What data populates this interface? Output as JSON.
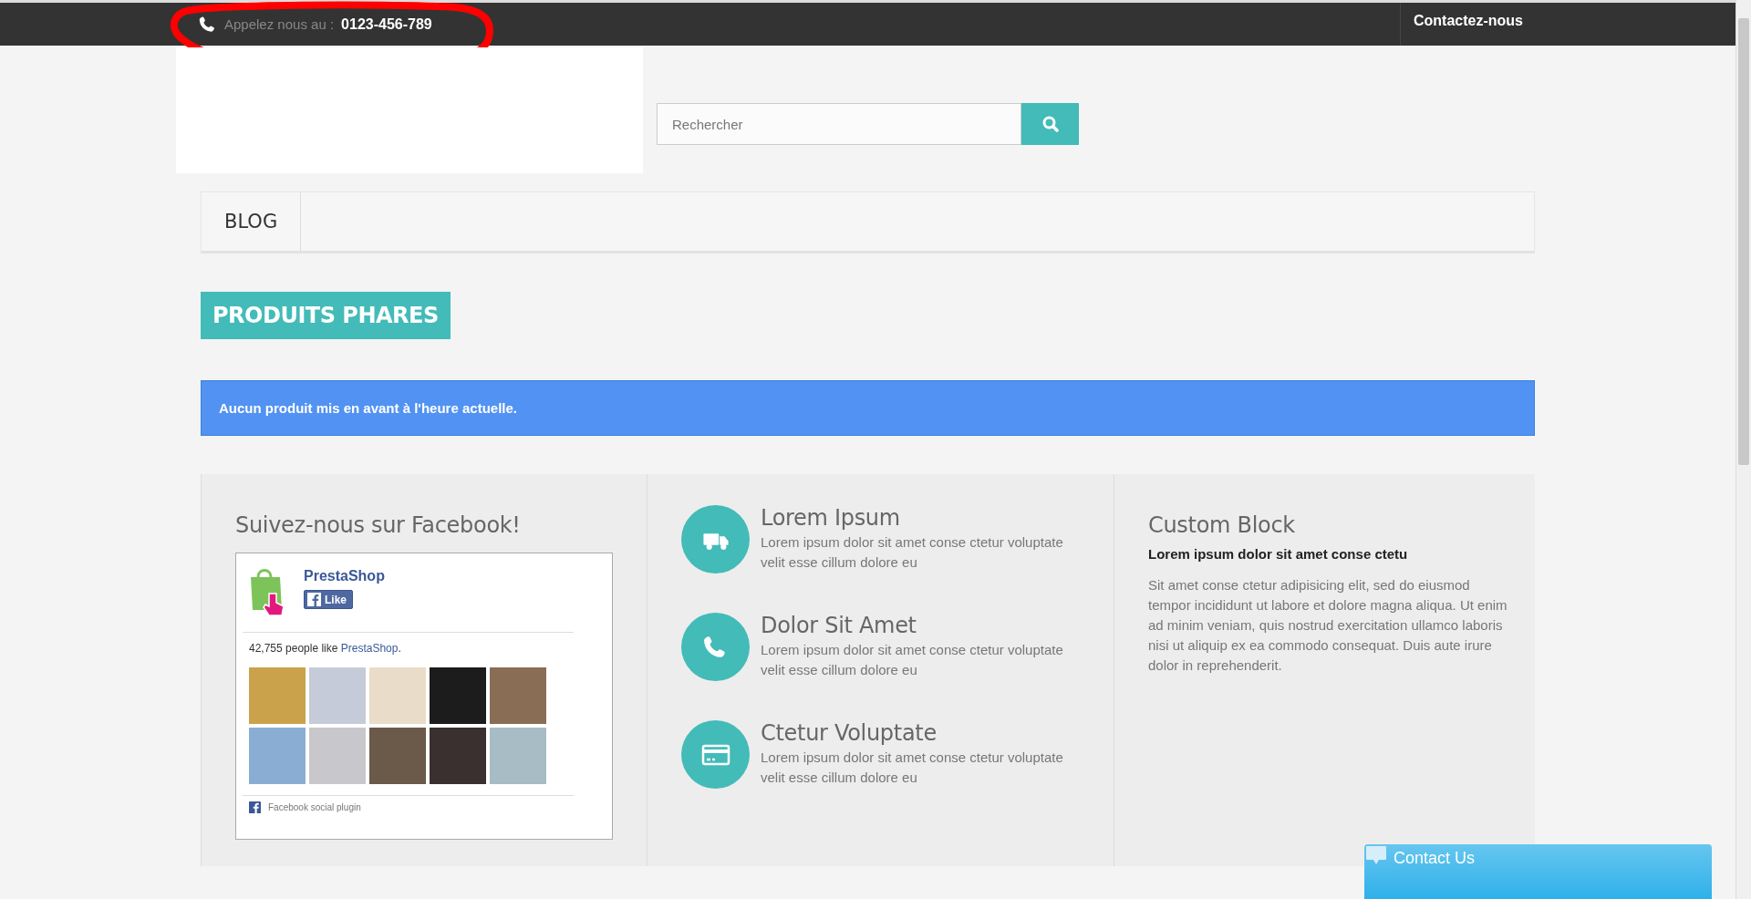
{
  "top_bar": {
    "phone_label": "Appelez nous au :",
    "phone_number": "0123-456-789",
    "contact_link": "Contactez-nous"
  },
  "search": {
    "placeholder": "Rechercher"
  },
  "menu": {
    "items": [
      "BLOG"
    ]
  },
  "featured": {
    "title": "PRODUITS PHARES",
    "alert": "Aucun produit mis en avant à l'heure actuelle."
  },
  "facebook": {
    "title": "Suivez-nous sur Facebook!",
    "page_name": "PrestaShop",
    "like_button": "Like",
    "likes_before": "42,755 people like ",
    "likes_link": "PrestaShop",
    "likes_after": ".",
    "plugin_label": "Facebook social plugin"
  },
  "features": [
    {
      "kind": "truck",
      "title": "Lorem Ipsum",
      "text": "Lorem ipsum dolor sit amet conse ctetur voluptate velit esse cillum dolore eu"
    },
    {
      "kind": "phone",
      "title": "Dolor Sit Amet",
      "text": "Lorem ipsum dolor sit amet conse ctetur voluptate velit esse cillum dolore eu"
    },
    {
      "kind": "card",
      "title": "Ctetur Voluptate",
      "text": "Lorem ipsum dolor sit amet conse ctetur voluptate velit esse cillum dolore eu"
    }
  ],
  "custom_block": {
    "title": "Custom Block",
    "subtitle": "Lorem ipsum dolor sit amet conse ctetu",
    "text": "Sit amet conse ctetur adipisicing elit, sed do eiusmod tempor incididunt ut labore et dolore magna aliqua. Ut enim ad minim veniam, quis nostrud exercitation ullamco laboris nisi ut aliquip ex ea commodo consequat. Duis aute irure dolor in reprehenderit."
  },
  "chat_widget": {
    "label": "Contact Us"
  }
}
